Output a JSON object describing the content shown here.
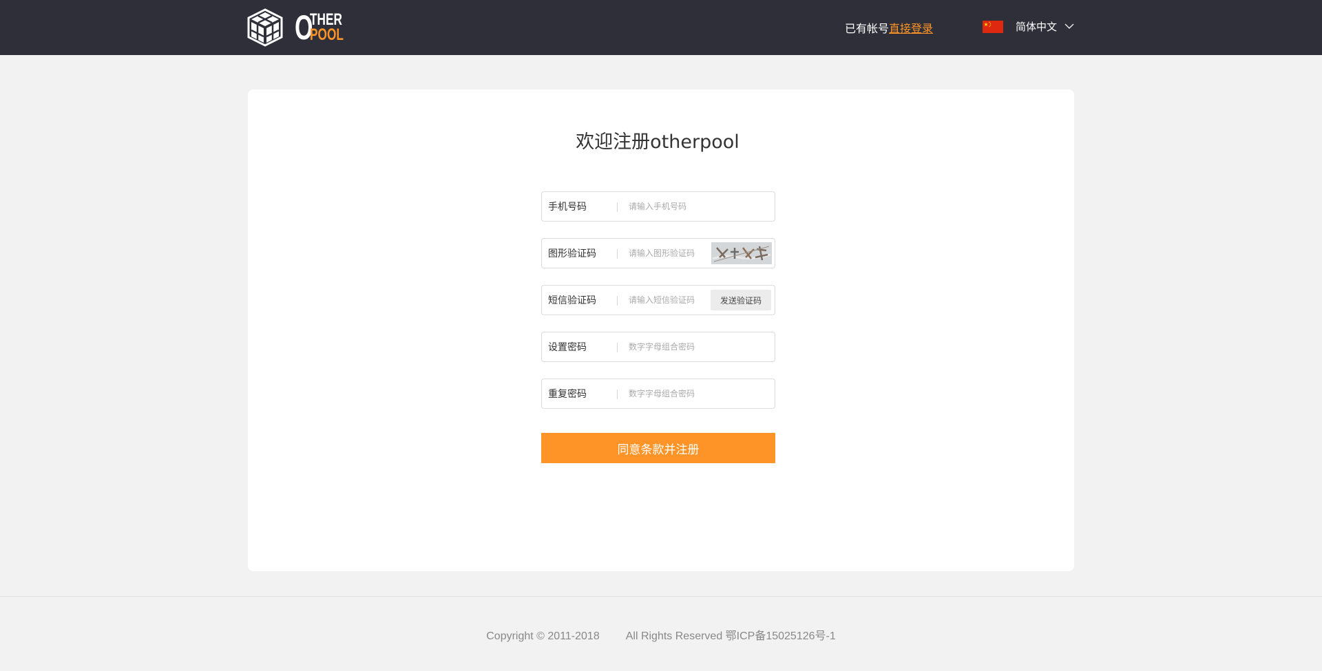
{
  "header": {
    "logo_text_o": "O",
    "logo_text_ther": "THER",
    "logo_text_pool": "POOL",
    "login_prompt": "已有帐号",
    "login_link": "直接登录",
    "language": "简体中文"
  },
  "card": {
    "title": "欢迎注册otherpool",
    "fields": [
      {
        "label": "手机号码",
        "placeholder": "请输入手机号码"
      },
      {
        "label": "图形验证码",
        "placeholder": "请输入图形验证码"
      },
      {
        "label": "短信验证码",
        "placeholder": "请输入短信验证码"
      },
      {
        "label": "设置密码",
        "placeholder": "数字字母组合密码"
      },
      {
        "label": "重复密码",
        "placeholder": "数字字母组合密码"
      }
    ],
    "sms_button": "发送验证码",
    "submit": "同意条款并注册"
  },
  "footer": {
    "copyright": "Copyright © 2011-2018",
    "rights": "All Rights Reserved 鄂ICP备15025126号-1"
  },
  "colors": {
    "header_bg": "#2e2f39",
    "accent": "#fe9428",
    "page_bg": "#f2f2f2"
  }
}
